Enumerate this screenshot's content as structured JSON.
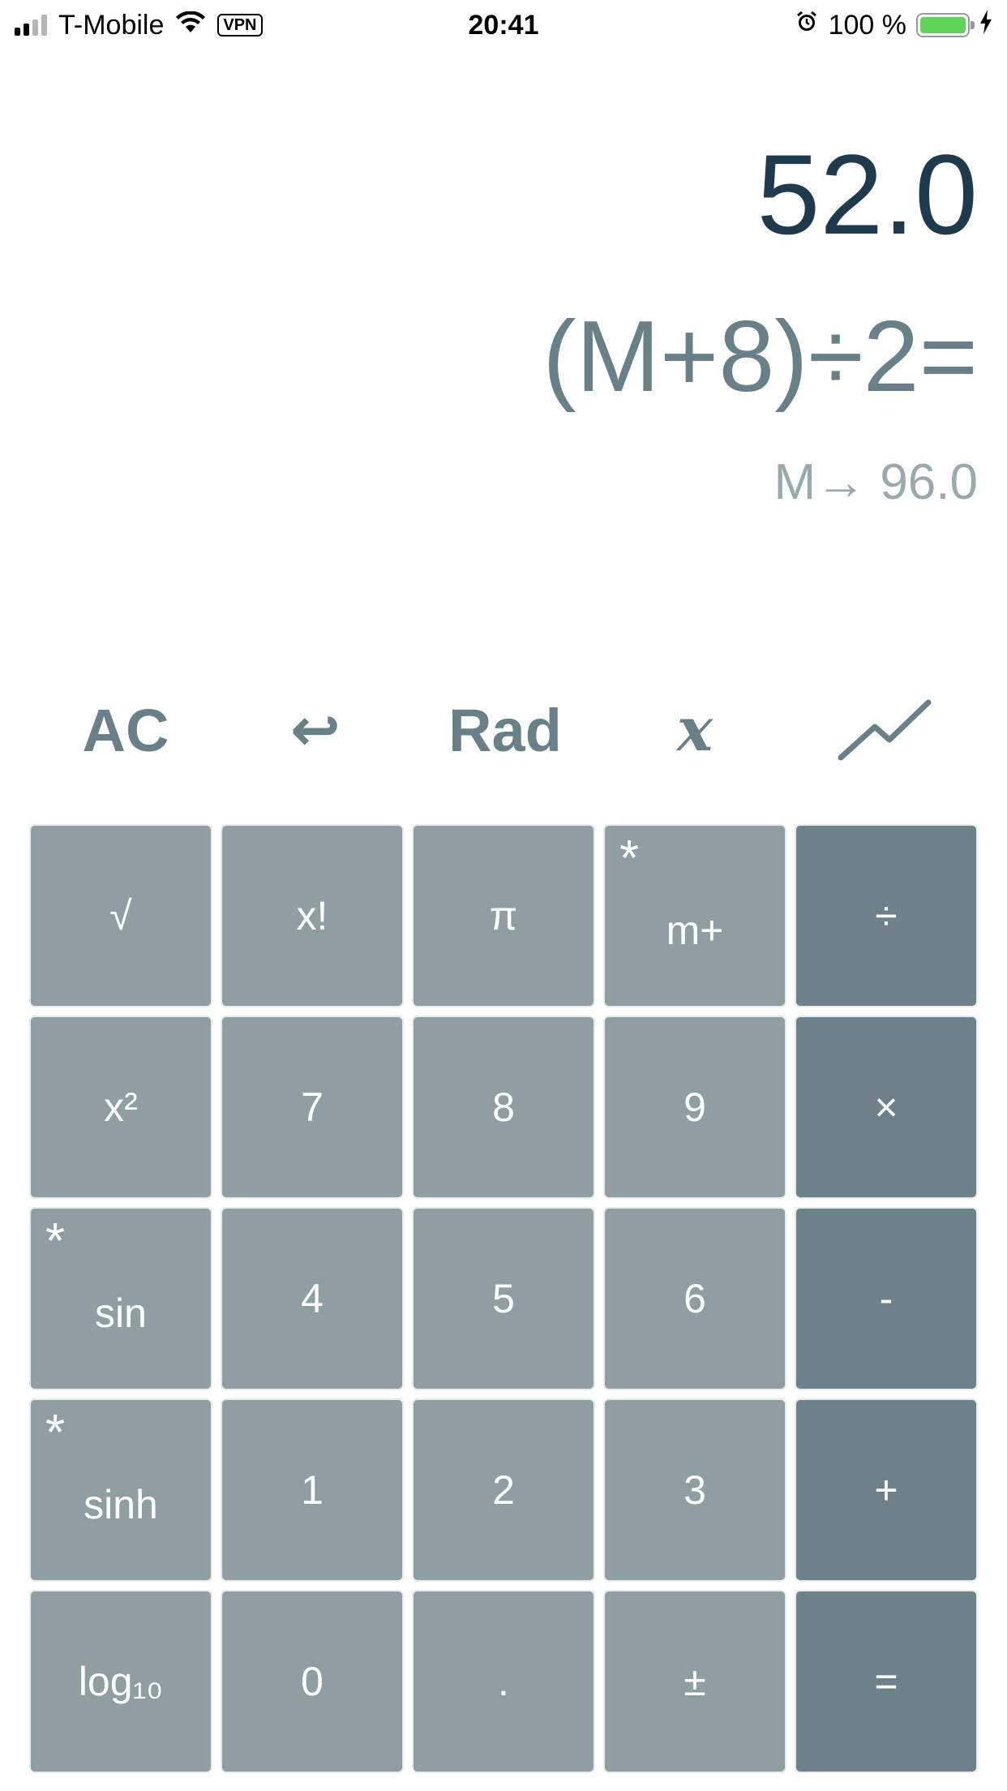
{
  "status_bar": {
    "carrier": "T-Mobile",
    "vpn": "VPN",
    "time": "20:41",
    "battery_text": "100 %",
    "battery_level": 1.0,
    "battery_color": "#5fd35a",
    "icons": [
      "signal-icon",
      "wifi-icon",
      "alarm-icon",
      "battery-icon",
      "charging-bolt-icon"
    ]
  },
  "display": {
    "result": "52.0",
    "expression": "(M+8)÷2=",
    "memory": "M→ 96.0"
  },
  "function_row": {
    "clear": "AC",
    "undo_icon": "undo-arrow-icon",
    "undo_glyph": "↩",
    "angle_mode": "Rad",
    "variable": "x",
    "graph_icon": "graph-line-icon"
  },
  "keypad": {
    "rows": [
      [
        {
          "label": "√",
          "star": false,
          "type": "func"
        },
        {
          "label": "x!",
          "star": false,
          "type": "func"
        },
        {
          "label": "π",
          "star": false,
          "type": "func"
        },
        {
          "label": "m+",
          "star": true,
          "type": "func"
        },
        {
          "label": "÷",
          "star": false,
          "type": "op"
        }
      ],
      [
        {
          "label": "x²",
          "star": false,
          "type": "func"
        },
        {
          "label": "7",
          "star": false,
          "type": "digit"
        },
        {
          "label": "8",
          "star": false,
          "type": "digit"
        },
        {
          "label": "9",
          "star": false,
          "type": "digit"
        },
        {
          "label": "×",
          "star": false,
          "type": "op"
        }
      ],
      [
        {
          "label": "sin",
          "star": true,
          "type": "func"
        },
        {
          "label": "4",
          "star": false,
          "type": "digit"
        },
        {
          "label": "5",
          "star": false,
          "type": "digit"
        },
        {
          "label": "6",
          "star": false,
          "type": "digit"
        },
        {
          "label": "-",
          "star": false,
          "type": "op"
        }
      ],
      [
        {
          "label": "sinh",
          "star": true,
          "type": "func"
        },
        {
          "label": "1",
          "star": false,
          "type": "digit"
        },
        {
          "label": "2",
          "star": false,
          "type": "digit"
        },
        {
          "label": "3",
          "star": false,
          "type": "digit"
        },
        {
          "label": "+",
          "star": false,
          "type": "op"
        }
      ],
      [
        {
          "label": "log₁₀",
          "star": false,
          "type": "func"
        },
        {
          "label": "0",
          "star": false,
          "type": "digit"
        },
        {
          "label": ".",
          "star": false,
          "type": "digit"
        },
        {
          "label": "±",
          "star": false,
          "type": "func"
        },
        {
          "label": "=",
          "star": false,
          "type": "op"
        }
      ]
    ],
    "star_glyph": "*"
  },
  "colors": {
    "result_text": "#1e3a4b",
    "expression_text": "#6a8088",
    "memory_text": "#9aa9ae",
    "key_bg": "#8f9ea0",
    "operator_key_bg": "#6c8189",
    "key_text": "#ffffff"
  }
}
